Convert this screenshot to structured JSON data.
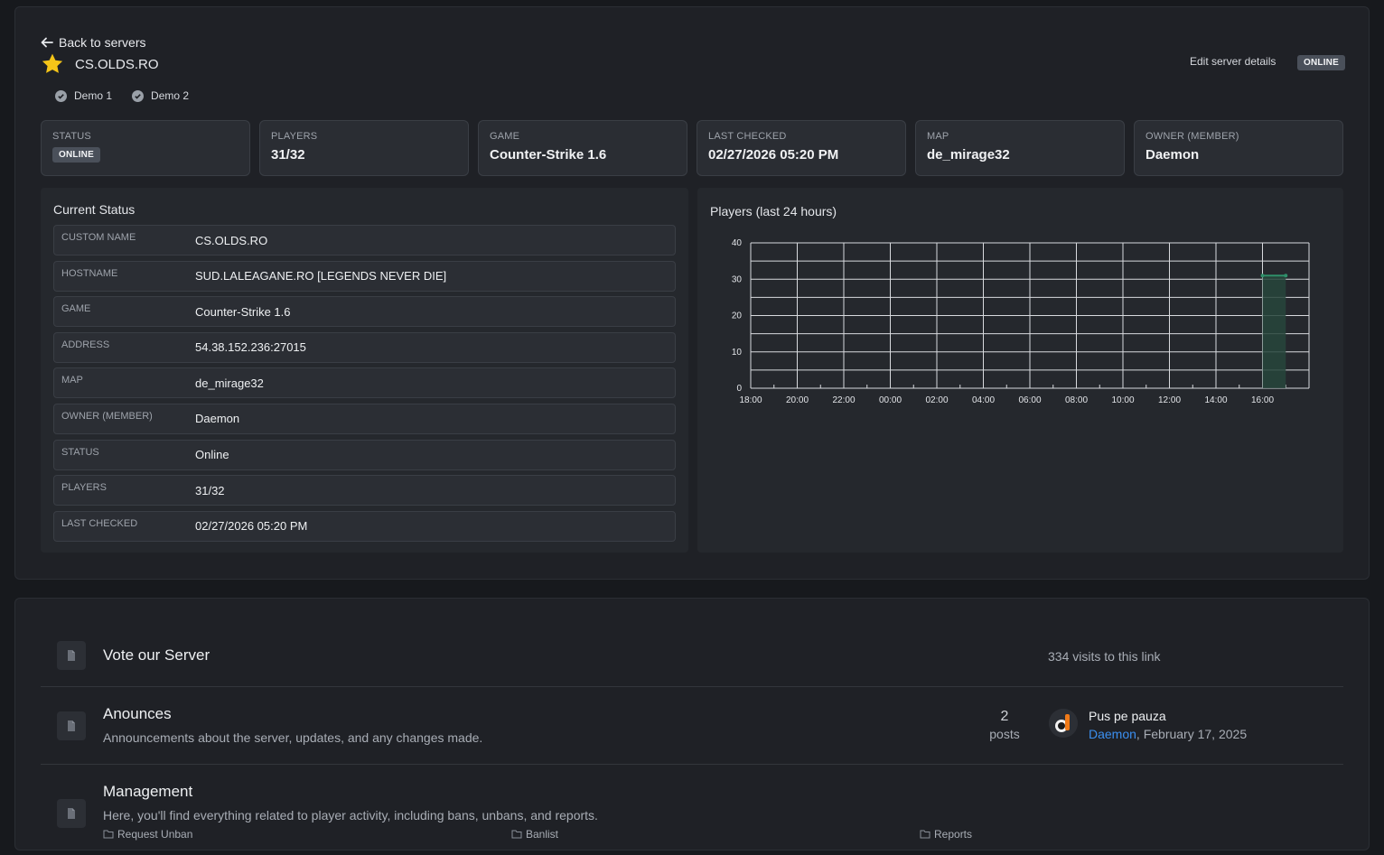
{
  "header": {
    "back_label": "Back to servers",
    "server_name": "CS.OLDS.RO",
    "edit_label": "Edit server details",
    "status_badge": "ONLINE"
  },
  "demos": [
    {
      "label": "Demo 1"
    },
    {
      "label": "Demo 2"
    }
  ],
  "stats": [
    {
      "label": "STATUS",
      "value": "ONLINE",
      "is_badge": true
    },
    {
      "label": "PLAYERS",
      "value": "31/32"
    },
    {
      "label": "GAME",
      "value": "Counter-Strike 1.6"
    },
    {
      "label": "LAST CHECKED",
      "value": "02/27/2026 05:20 PM"
    },
    {
      "label": "MAP",
      "value": "de_mirage32"
    },
    {
      "label": "OWNER (MEMBER)",
      "value": "Daemon"
    }
  ],
  "current_status": {
    "heading": "Current Status",
    "rows": [
      {
        "key": "CUSTOM NAME",
        "value": "CS.OLDS.RO"
      },
      {
        "key": "HOSTNAME",
        "value": "SUD.LALEAGANE.RO [LEGENDS NEVER DIE]"
      },
      {
        "key": "GAME",
        "value": "Counter-Strike 1.6"
      },
      {
        "key": "ADDRESS",
        "value": "54.38.152.236:27015"
      },
      {
        "key": "MAP",
        "value": "de_mirage32"
      },
      {
        "key": "OWNER (MEMBER)",
        "value": "Daemon"
      },
      {
        "key": "STATUS",
        "value": "Online"
      },
      {
        "key": "PLAYERS",
        "value": "31/32"
      },
      {
        "key": "LAST CHECKED",
        "value": "02/27/2026 05:20 PM"
      }
    ]
  },
  "chart_data": {
    "type": "area",
    "title": "Players (last 24 hours)",
    "xlabel": "",
    "ylabel": "",
    "x_ticks": [
      "18:00",
      "20:00",
      "22:00",
      "00:00",
      "02:00",
      "04:00",
      "06:00",
      "08:00",
      "10:00",
      "12:00",
      "14:00",
      "16:00"
    ],
    "y_ticks": [
      0,
      10,
      20,
      30,
      40
    ],
    "ylim": [
      0,
      40
    ],
    "grid": true,
    "series": [
      {
        "points": [
          {
            "x": "16:00",
            "y": 31
          },
          {
            "x": "17:00",
            "y": 31
          }
        ]
      }
    ],
    "line_color": "#2f8f6a",
    "fill_color": "#27453c"
  },
  "forums": {
    "vote": {
      "title": "Vote our Server",
      "visits": "334 visits to this link"
    },
    "announces": {
      "title": "Anounces",
      "description": "Announcements about the server, updates, and any changes made.",
      "posts_count": "2",
      "posts_label": "posts",
      "last_post_title": "Pus pe pauza",
      "last_post_author": "Daemon",
      "last_post_date": ", February 17, 2025"
    },
    "management": {
      "title": "Management",
      "description": "Here, you'll find everything related to player activity, including bans, unbans, and reports.",
      "subforums": [
        "Request Unban",
        "Banlist",
        "Reports"
      ]
    }
  },
  "colors": {
    "accent": "#3b8ff0",
    "star": "#f5c518",
    "badge": "#4a505a"
  }
}
